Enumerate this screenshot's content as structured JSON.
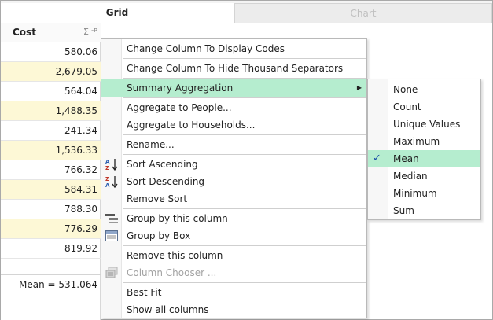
{
  "tabs": {
    "grid": "Grid",
    "chart": "Chart"
  },
  "column": {
    "title": "Cost",
    "sigma_symbol": "Σ",
    "pin_symbol": "-ᴘ",
    "values": [
      "580.06",
      "2,679.05",
      "564.04",
      "1,488.35",
      "241.34",
      "1,536.33",
      "766.32",
      "584.31",
      "788.30",
      "776.29",
      "819.92"
    ],
    "footer": "Mean = 531.064"
  },
  "menu": {
    "items": [
      "Change Column To Display Codes",
      "Change Column To Hide Thousand Separators",
      "Summary Aggregation",
      "Aggregate to People...",
      "Aggregate to Households...",
      "Rename...",
      "Sort Ascending",
      "Sort Descending",
      "Remove Sort",
      "Group by this column",
      "Group by Box",
      "Remove this column",
      "Column Chooser ...",
      "Best Fit",
      "Show all columns"
    ],
    "submenu_arrow": "▶"
  },
  "submenu": {
    "items": [
      "None",
      "Count",
      "Unique Values",
      "Maximum",
      "Mean",
      "Median",
      "Minimum",
      "Sum"
    ],
    "selected": "Mean",
    "check_symbol": "✓"
  },
  "colors": {
    "highlight": "#b5edcf",
    "alt_row": "#fdf8d6",
    "disabled_text": "#a3a3a3",
    "check": "#1a4ea8"
  }
}
